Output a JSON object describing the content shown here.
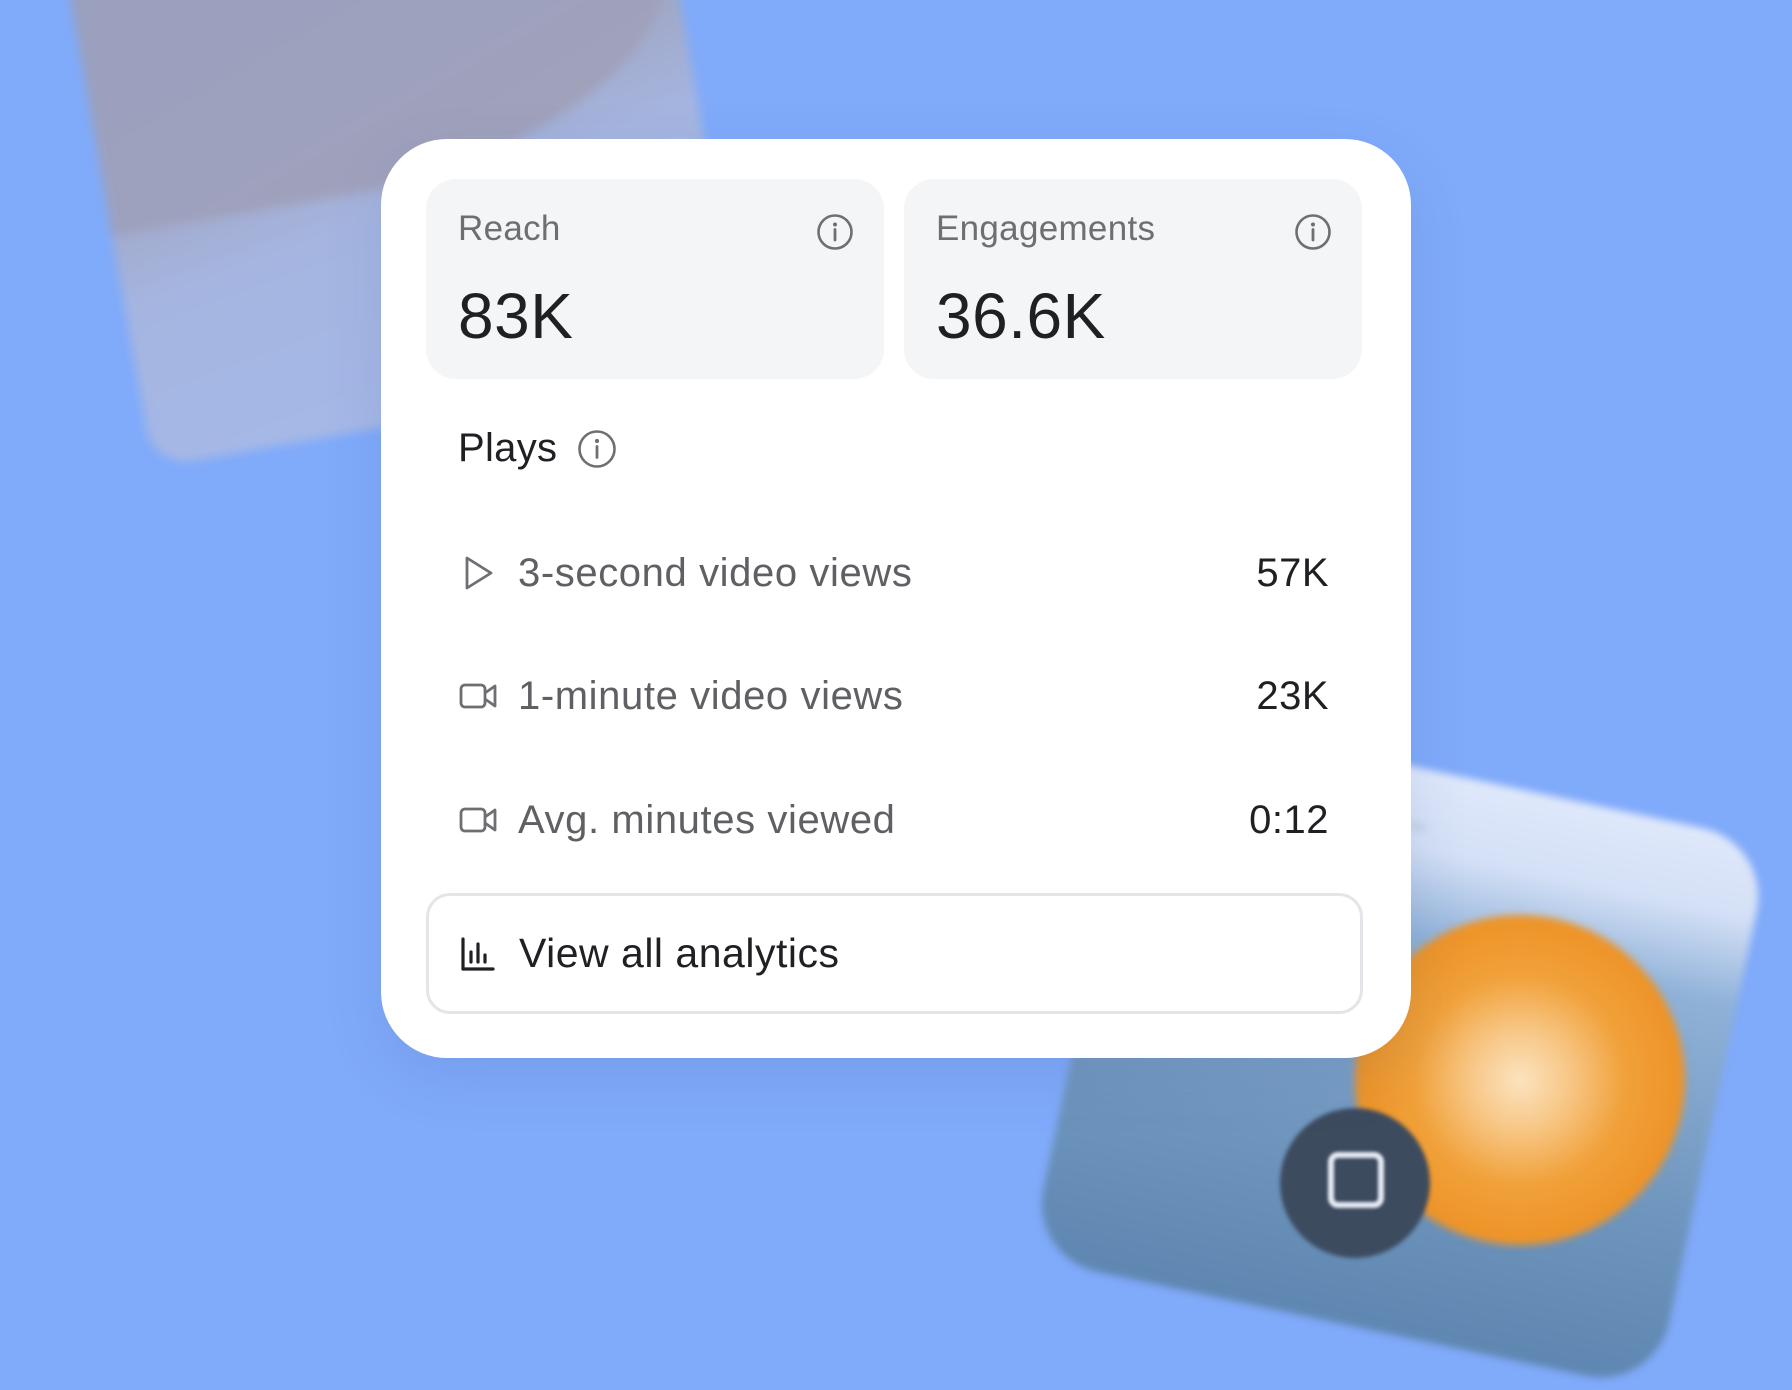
{
  "stats": {
    "reach": {
      "label": "Reach",
      "value": "83K"
    },
    "engagements": {
      "label": "Engagements",
      "value": "36.6K"
    }
  },
  "plays": {
    "title": "Plays",
    "rows": [
      {
        "icon": "play-icon",
        "label": "3-second video views",
        "value": "57K"
      },
      {
        "icon": "video-camera-icon",
        "label": "1-minute video views",
        "value": "23K"
      },
      {
        "icon": "video-camera-icon",
        "label": "Avg. minutes viewed",
        "value": "0:12"
      }
    ]
  },
  "footer": {
    "view_all_label": "View all analytics",
    "icon": "bar-chart-icon"
  },
  "colors": {
    "background": "#80aafa",
    "card": "#ffffff",
    "tile": "#f3f5f7",
    "text_primary": "#1e2023",
    "text_secondary": "#5e6064"
  }
}
